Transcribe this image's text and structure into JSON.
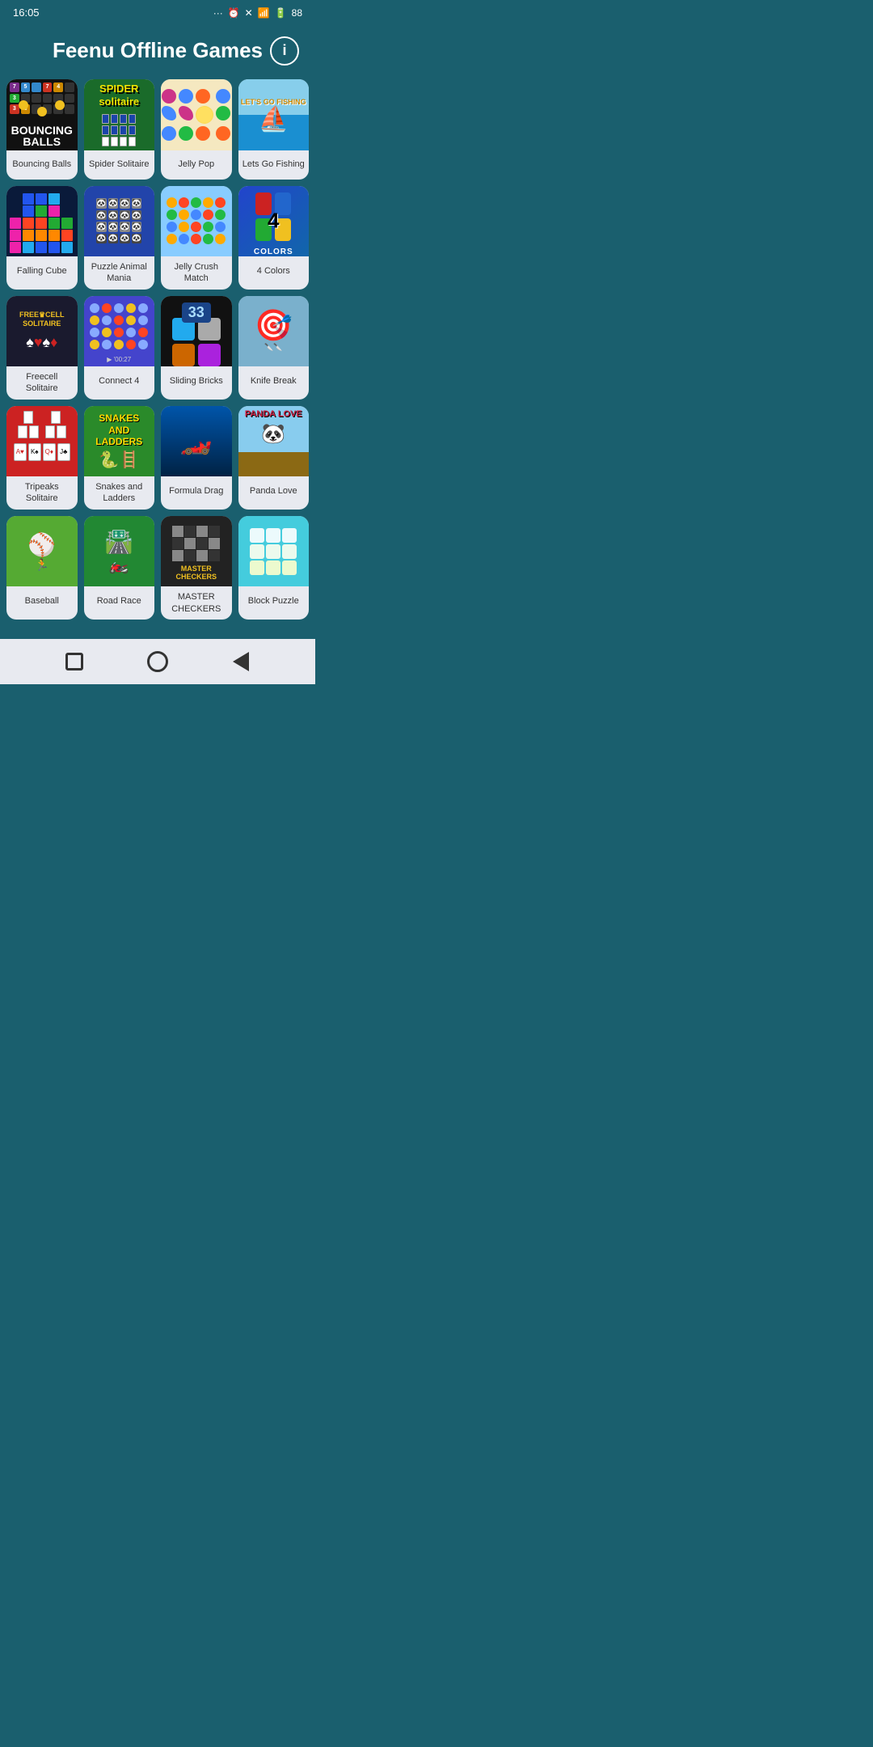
{
  "statusBar": {
    "time": "16:05",
    "battery": "88"
  },
  "header": {
    "title": "Feenu Offline Games",
    "infoLabel": "i"
  },
  "games": [
    {
      "id": "bouncing-balls",
      "label": "Bouncing Balls",
      "thumb": "bouncing"
    },
    {
      "id": "spider-solitaire",
      "label": "Spider Solitaire",
      "thumb": "spider"
    },
    {
      "id": "jelly-pop",
      "label": "Jelly Pop",
      "thumb": "jellypop"
    },
    {
      "id": "lets-go-fishing",
      "label": "Lets Go Fishing",
      "thumb": "fishing"
    },
    {
      "id": "falling-cube",
      "label": "Falling Cube",
      "thumb": "falling"
    },
    {
      "id": "puzzle-animal-mania",
      "label": "Puzzle Animal Mania",
      "thumb": "puzzle"
    },
    {
      "id": "jelly-crush-match",
      "label": "Jelly Crush Match",
      "thumb": "jellycrush"
    },
    {
      "id": "4-colors",
      "label": "4 Colors",
      "thumb": "4colors"
    },
    {
      "id": "freecell-solitaire",
      "label": "Freecell Solitaire",
      "thumb": "freecell"
    },
    {
      "id": "connect-4",
      "label": "Connect 4",
      "thumb": "connect4"
    },
    {
      "id": "sliding-bricks",
      "label": "Sliding Bricks",
      "thumb": "sliding"
    },
    {
      "id": "knife-break",
      "label": "Knife Break",
      "thumb": "knife"
    },
    {
      "id": "tripeaks-solitaire",
      "label": "Tripeaks Solitaire",
      "thumb": "tripeaks"
    },
    {
      "id": "snakes-and-ladders",
      "label": "Snakes and Ladders",
      "thumb": "snakes"
    },
    {
      "id": "formula-drag",
      "label": "Formula Drag",
      "thumb": "formula"
    },
    {
      "id": "panda-love",
      "label": "Panda Love",
      "thumb": "panda"
    },
    {
      "id": "baseball",
      "label": "Baseball",
      "thumb": "baseball"
    },
    {
      "id": "road-race",
      "label": "Road Race",
      "thumb": "road"
    },
    {
      "id": "master-checkers",
      "label": "MASTER CHECKERS",
      "thumb": "checkers"
    },
    {
      "id": "block-puzzle",
      "label": "Block Puzzle",
      "thumb": "iso"
    }
  ],
  "navBar": {
    "squareLabel": "square",
    "circleLabel": "circle",
    "triangleLabel": "back"
  }
}
